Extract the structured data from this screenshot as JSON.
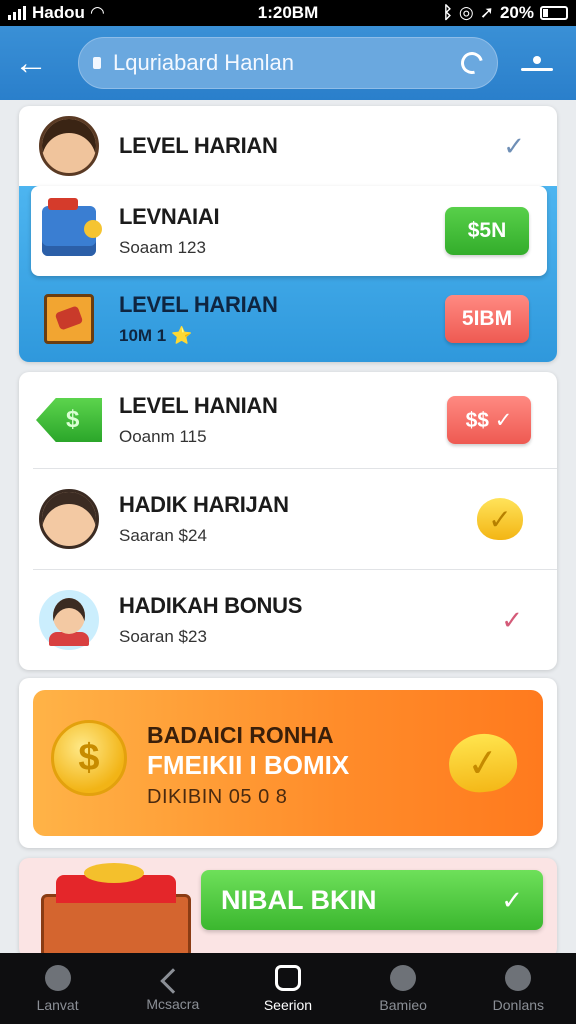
{
  "status_bar": {
    "carrier": "Hadou",
    "time": "1:20BM",
    "battery": "20%"
  },
  "header": {
    "address": "Lquriabard Hanlan"
  },
  "list1": {
    "items": [
      {
        "title": "LEVEL HARIAN",
        "sub": "",
        "trailing": "✓"
      },
      {
        "title": "LEVNAIAI",
        "sub": "Soaam 123",
        "trailing": "$5N"
      },
      {
        "title": "LEVEL HARIAN",
        "sub": "10M 1 ⭐",
        "trailing": "5IBM"
      }
    ]
  },
  "list2": {
    "items": [
      {
        "title": "LEVEL HANIAN",
        "sub": "Ooanm 115",
        "trailing": "$$ ✓"
      },
      {
        "title": "HADIK HARIJAN",
        "sub": "Saaran $24",
        "trailing": "✓"
      },
      {
        "title": "HADIKAH BONUS",
        "sub": "Soaran $23",
        "trailing": "✓"
      }
    ]
  },
  "banner": {
    "title": "BADAICI RONHA",
    "subtitle": "FMEIKII I BOMIX",
    "date": "DIKIBIN 05 0 8"
  },
  "promo": {
    "button": "NIBAL BKIN"
  },
  "tabs": [
    {
      "label": "Lanvat",
      "icon": "person-icon"
    },
    {
      "label": "Mcsacra",
      "icon": "chevron-left-icon"
    },
    {
      "label": "Seerion",
      "icon": "home-icon",
      "active": true
    },
    {
      "label": "Bamieo",
      "icon": "profile-icon"
    },
    {
      "label": "Donlans",
      "icon": "user-icon"
    }
  ],
  "colors": {
    "header_blue": "#2f86cf",
    "highlight_blue": "#43a8ea",
    "orange": "#ff8c2a",
    "green": "#3bb72f",
    "red": "#ee5a52"
  }
}
